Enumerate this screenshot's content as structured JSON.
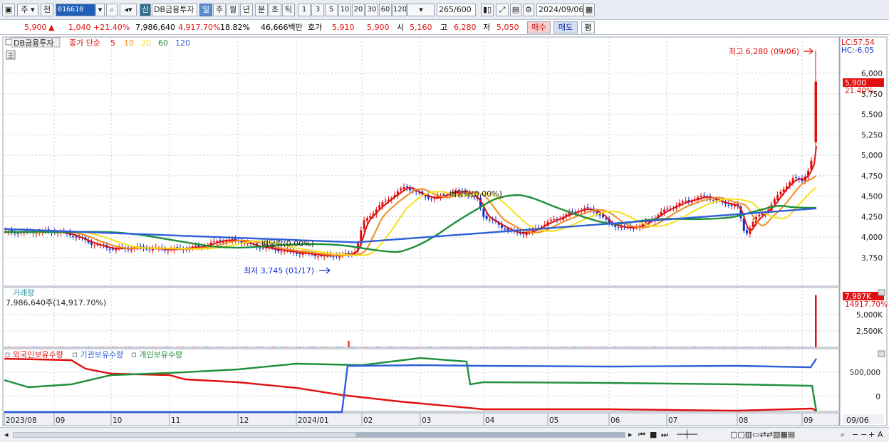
{
  "toolbar": {
    "mode_a": "주",
    "mode_b": "전",
    "stock_code": "016610",
    "new_badge": "신",
    "stock_name": "DB금융투자",
    "periods": [
      "일",
      "주",
      "월",
      "년",
      "분",
      "초",
      "틱"
    ],
    "selected_period": "일",
    "intervals": [
      "1",
      "3",
      "5",
      "10",
      "20",
      "30",
      "60",
      "120"
    ],
    "count_value": "265",
    "count_max": "/600",
    "date_value": "2024/09/06"
  },
  "quote": {
    "price": "5,900",
    "change_arrow": "▲",
    "change": "1,040",
    "change_pct": "+21.40%",
    "volume": "7,986,640",
    "volume_ratio": "4,917.70%",
    "turnover": "18.82%",
    "amount": "46,666백만",
    "ask_label": "호가",
    "ask": "5,910",
    "bid": "5,900",
    "open_label": "시",
    "open": "5,160",
    "high_label": "고",
    "high": "6,280",
    "low_label": "저",
    "low": "5,050",
    "buy_label": "매수",
    "sell_label": "매도",
    "avg_label": "평"
  },
  "price_panel": {
    "stock_tag": "DB금융투자",
    "ma_label": "종가 단순",
    "ma_periods": [
      {
        "label": "5",
        "color": "#e01010"
      },
      {
        "label": "10",
        "color": "#f08c1c"
      },
      {
        "label": "20",
        "color": "#f5e21a"
      },
      {
        "label": "60",
        "color": "#1f8f3a"
      },
      {
        "label": "120",
        "color": "#2f5fd8"
      }
    ],
    "lc_label": "LC:57.54",
    "hc_label": "HC:-6.05",
    "price_axis_ticks": [
      "6,000",
      "5,750",
      "5,500",
      "5,250",
      "5,000",
      "4,750",
      "4,500",
      "4,250",
      "4,000",
      "3,750"
    ],
    "current_price_tag": "5,900",
    "current_pct_tag": "21.40%",
    "high_annotation": "최고 6,280 (09/06)",
    "low_annotation": "최저 3,745 (01/17)",
    "dividend_annotations": [
      "배당락(0.00%)",
      "배당락(0.00%)"
    ]
  },
  "volume_panel": {
    "title": "거래량",
    "value": "7,986,640주(14,917.70%)",
    "axis_ticks": [
      "5,000K",
      "2,500K"
    ],
    "current_tag": "7,987K",
    "current_pct_tag": "14917.70%"
  },
  "holding_panel": {
    "legend": [
      {
        "label": "외국인보유수량",
        "color": "#e01010"
      },
      {
        "label": "기관보유수량",
        "color": "#2f5fd8"
      },
      {
        "label": "개인보유수량",
        "color": "#1f8f3a"
      }
    ],
    "axis_ticks": [
      "500,000",
      "0"
    ]
  },
  "date_axis": {
    "labels": [
      "2023/08",
      "09",
      "10",
      "11",
      "12",
      "2024/01",
      "02",
      "03",
      "04",
      "05",
      "06",
      "07",
      "08",
      "09"
    ],
    "current_date_tag": "09/06"
  },
  "chart_data": [
    {
      "type": "line",
      "title": "DB금융투자 일봉",
      "x": [
        "2023/08",
        "2023/09",
        "2023/10",
        "2023/11",
        "2023/12",
        "2024/01/17",
        "2024/02",
        "2024/03",
        "2024/04",
        "2024/05",
        "2024/06",
        "2024/07",
        "2024/08",
        "2024/09/06"
      ],
      "series": [
        {
          "name": "5",
          "values": [
            4060,
            4040,
            3860,
            3860,
            3950,
            3760,
            4560,
            4520,
            4000,
            4270,
            4100,
            4470,
            4250,
            5900
          ]
        },
        {
          "name": "120",
          "values": [
            4100,
            4080,
            4050,
            4010,
            3980,
            3940,
            3960,
            4030,
            4090,
            4130,
            4160,
            4220,
            4300,
            4350
          ]
        }
      ],
      "ylim": [
        3650,
        6400
      ],
      "annotations": [
        "최고 6,280 (09/06)",
        "최저 3,745 (01/17)"
      ]
    },
    {
      "type": "bar",
      "title": "거래량",
      "categories": [
        "2024/09/06"
      ],
      "values": [
        7986640
      ]
    }
  ]
}
